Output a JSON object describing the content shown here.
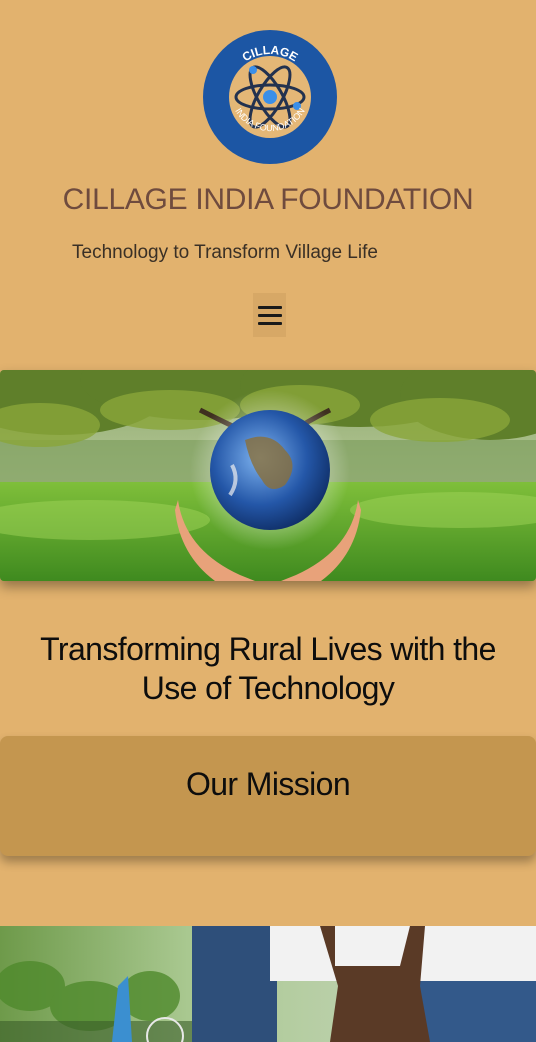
{
  "header": {
    "logo": {
      "top_text": "CILLAGE",
      "bottom_text": "INDIA FOUNDATION",
      "icon": "atom-icon"
    },
    "site_title": "CILLAGE INDIA FOUNDATION",
    "tagline": "Technology to Transform Village Life",
    "menu_icon": "hamburger-menu-icon"
  },
  "hero": {
    "image": "globe-in-hands-under-tree-image"
  },
  "main": {
    "headline_line1": "Transforming Rural Lives with the",
    "headline_line2": "Use of Technology",
    "mission_title": "Our Mission"
  },
  "colors": {
    "page_background": "#e2b26e",
    "title_color": "#6f4b3e",
    "card_background": "#c4964f",
    "logo_blue": "#1c56a4"
  }
}
